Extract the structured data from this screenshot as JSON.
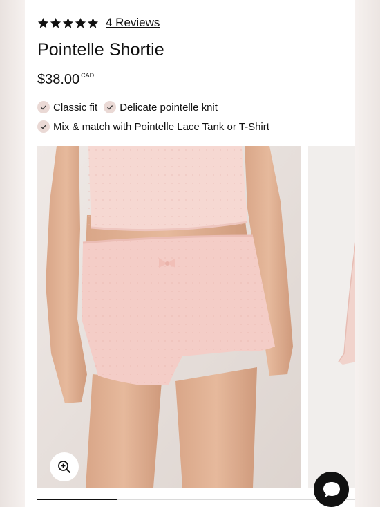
{
  "product": {
    "rating": 5,
    "rating_max": 5,
    "reviews_label": "4 Reviews",
    "title": "Pointelle Shortie",
    "price": "$38.00",
    "currency": "CAD"
  },
  "features": [
    "Classic fit",
    "Delicate pointelle knit",
    "Mix & match with Pointelle Lace Tank or T-Shirt"
  ],
  "gallery": {
    "progress_fraction": 0.25
  },
  "colors": {
    "accent_blush": "#ead9d5",
    "garment_pink": "#f4cdc7",
    "text": "#111111"
  },
  "icons": {
    "star": "star-icon",
    "check": "checkmark-icon",
    "zoom": "zoom-in-icon",
    "chat": "chat-bubble-icon"
  }
}
